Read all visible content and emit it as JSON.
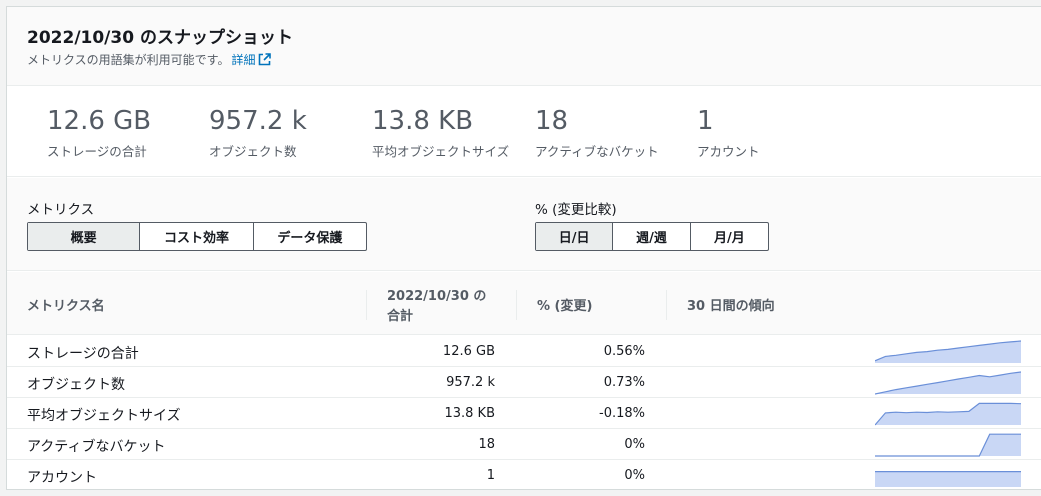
{
  "header": {
    "title": "2022/10/30 のスナップショット",
    "subtitle": "メトリクスの用語集が利用可能です。",
    "link_label": "詳細"
  },
  "stats": [
    {
      "value": "12.6 GB",
      "label": "ストレージの合計"
    },
    {
      "value": "957.2 k",
      "label": "オブジェクト数"
    },
    {
      "value": "13.8 KB",
      "label": "平均オブジェクトサイズ"
    },
    {
      "value": "18",
      "label": "アクティブなバケット"
    },
    {
      "value": "1",
      "label": "アカウント"
    }
  ],
  "controls": {
    "metrics_label": "メトリクス",
    "metrics_options": [
      "概要",
      "コスト効率",
      "データ保護"
    ],
    "metrics_selected": "概要",
    "compare_label": "% (変更比較)",
    "compare_options": [
      "日/日",
      "週/週",
      "月/月"
    ],
    "compare_selected": "日/日"
  },
  "table": {
    "headers": [
      "メトリクス名",
      "2022/10/30 の",
      "合計",
      "% (変更)",
      "30 日間の傾向"
    ],
    "rows": [
      {
        "name": "ストレージの合計",
        "value": "12.6 GB",
        "change": "0.56%",
        "trend": [
          0.1,
          0.3,
          0.35,
          0.42,
          0.48,
          0.52,
          0.58,
          0.62,
          0.68,
          0.74,
          0.8,
          0.86,
          0.92,
          0.96,
          1.0
        ]
      },
      {
        "name": "オブジェクト数",
        "value": "957.2 k",
        "change": "0.73%",
        "trend": [
          0.0,
          0.1,
          0.2,
          0.28,
          0.36,
          0.44,
          0.52,
          0.6,
          0.68,
          0.76,
          0.84,
          0.78,
          0.86,
          0.94,
          1.0
        ]
      },
      {
        "name": "平均オブジェクトサイズ",
        "value": "13.8 KB",
        "change": "-0.18%",
        "trend": [
          0.0,
          0.55,
          0.58,
          0.56,
          0.58,
          0.57,
          0.6,
          0.58,
          0.6,
          0.62,
          0.98,
          0.98,
          0.98,
          0.98,
          0.97
        ]
      },
      {
        "name": "アクティブなバケット",
        "value": "18",
        "change": "0%",
        "trend": [
          0.0,
          0.0,
          0.0,
          0.0,
          0.0,
          0.0,
          0.0,
          0.0,
          0.0,
          0.0,
          0.0,
          0.99,
          0.99,
          0.99,
          0.99
        ]
      },
      {
        "name": "アカウント",
        "value": "1",
        "change": "0%",
        "trend": [
          0.7,
          0.7,
          0.7,
          0.7,
          0.7,
          0.7,
          0.7,
          0.7,
          0.7,
          0.7,
          0.7,
          0.7,
          0.7,
          0.7,
          0.7
        ]
      }
    ]
  },
  "colors": {
    "accent": "#0073bb",
    "sparkline_fill": "#c9d7f5",
    "sparkline_stroke": "#6a8fd8"
  },
  "icons": {
    "external_link": "external-link-icon"
  }
}
